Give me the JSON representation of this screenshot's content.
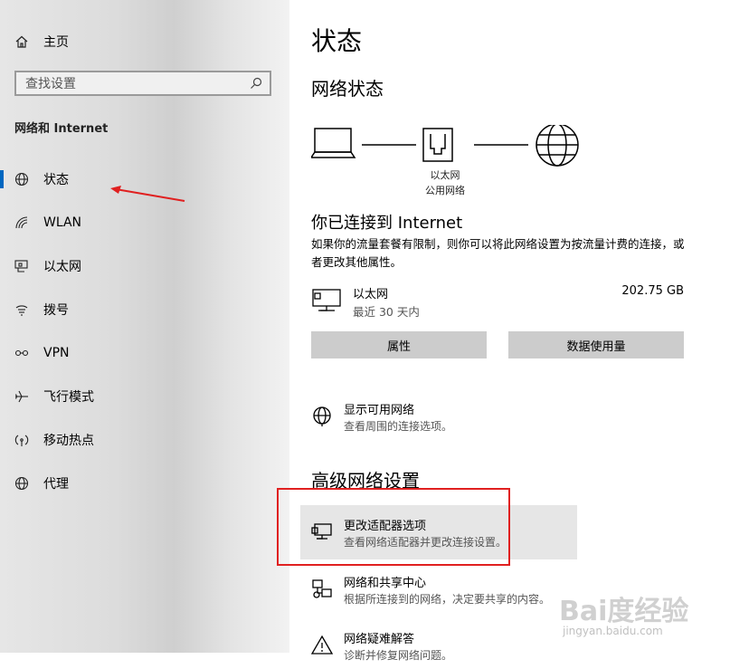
{
  "sidebar": {
    "home_label": "主页",
    "search_placeholder": "查找设置",
    "section_title": "网络和 Internet",
    "items": [
      {
        "label": "状态",
        "icon": "globe-status-icon",
        "active": true
      },
      {
        "label": "WLAN",
        "icon": "wifi-icon"
      },
      {
        "label": "以太网",
        "icon": "ethernet-icon"
      },
      {
        "label": "拨号",
        "icon": "dialup-icon"
      },
      {
        "label": "VPN",
        "icon": "vpn-icon"
      },
      {
        "label": "飞行模式",
        "icon": "airplane-icon"
      },
      {
        "label": "移动热点",
        "icon": "hotspot-icon"
      },
      {
        "label": "代理",
        "icon": "globe-icon"
      }
    ]
  },
  "main": {
    "title": "状态",
    "network_status_heading": "网络状态",
    "diagram": {
      "adapter_label": "以太网",
      "network_label": "公用网络"
    },
    "connected_heading": "你已连接到 Internet",
    "connected_desc": "如果你的流量套餐有限制，则你可以将此网络设置为按流量计费的连接，或者更改其他属性。",
    "ethernet": {
      "name": "以太网",
      "period": "最近 30 天内",
      "usage": "202.75 GB"
    },
    "buttons": {
      "properties": "属性",
      "data_usage": "数据使用量"
    },
    "show_networks": {
      "title": "显示可用网络",
      "desc": "查看周围的连接选项。"
    },
    "advanced_heading": "高级网络设置",
    "adapter_options": {
      "title": "更改适配器选项",
      "desc": "查看网络适配器并更改连接设置。"
    },
    "sharing_center": {
      "title": "网络和共享中心",
      "desc": "根据所连接到的网络，决定要共享的内容。"
    },
    "troubleshoot": {
      "title": "网络疑难解答",
      "desc": "诊断并修复网络问题。"
    }
  },
  "watermark": {
    "brand": "Bai度经验",
    "url": "jingyan.baidu.com"
  },
  "colors": {
    "accent": "#0067c0",
    "annotation": "#e02020"
  }
}
